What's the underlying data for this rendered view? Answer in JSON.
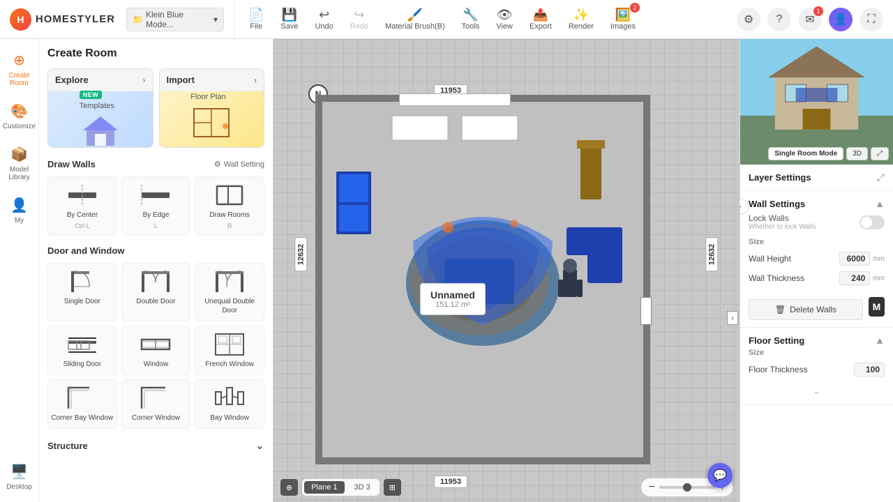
{
  "app": {
    "name": "HOMESTYLER",
    "file": "Klein Blue Mode...",
    "logo_letter": "H"
  },
  "toolbar": {
    "file_label": "File",
    "save_label": "Save",
    "undo_label": "Undo",
    "redo_label": "Redo",
    "material_brush_label": "Material Brush(B)",
    "tools_label": "Tools",
    "view_label": "View",
    "export_label": "Export",
    "render_label": "Render",
    "images_label": "Images",
    "images_badge": "2"
  },
  "sidebar": {
    "create_room_title": "Create Room",
    "explore_label": "Explore",
    "explore_sub": "Templates",
    "new_badge": "NEW",
    "import_label": "Import",
    "import_sub": "Floor Plan",
    "draw_walls_title": "Draw Walls",
    "wall_setting_label": "Wall Setting",
    "walls": [
      {
        "label": "By Center",
        "shortcut": "Ctrl L",
        "icon": "⬜"
      },
      {
        "label": "By Edge",
        "shortcut": "L",
        "icon": "⬜"
      },
      {
        "label": "Draw Rooms",
        "shortcut": "R",
        "icon": "⬜"
      }
    ],
    "door_window_title": "Door and Window",
    "items": [
      {
        "label": "Single Door",
        "icon": "🚪"
      },
      {
        "label": "Double Door",
        "icon": "🚪"
      },
      {
        "label": "Unequal Double Door",
        "icon": "🚪"
      },
      {
        "label": "Sliding Door",
        "icon": "⊟"
      },
      {
        "label": "Window",
        "icon": "⊡"
      },
      {
        "label": "French Window",
        "icon": "⊠"
      },
      {
        "label": "Corner Bay Window",
        "icon": "⌐"
      },
      {
        "label": "Corner Window",
        "icon": "⌐"
      },
      {
        "label": "Bay Window",
        "icon": "⊞"
      }
    ],
    "structure_title": "Structure"
  },
  "nav": [
    {
      "label": "Create Room",
      "icon": "⊕",
      "active": true
    },
    {
      "label": "Customize",
      "icon": "🎨"
    },
    {
      "label": "Model Library",
      "icon": "📦"
    },
    {
      "label": "My",
      "icon": "👤"
    },
    {
      "label": "Desktop",
      "icon": "🖥️"
    }
  ],
  "canvas": {
    "room_name": "Unnamed",
    "room_area": "151.12 m²",
    "dim_top": "11953",
    "dim_bottom": "11953",
    "dim_left": "12632",
    "dim_right": "12632",
    "plane1_label": "Plane 1",
    "plane2_label": "3D 3"
  },
  "right_panel": {
    "preview_mode_single": "Single Room Mode",
    "preview_mode_3d": "3D",
    "layer_settings_title": "Layer Settings",
    "wall_settings_title": "Wall Settings",
    "lock_walls_label": "Lock Walls",
    "lock_walls_sub": "Whether to lock Walls",
    "size_label": "Size",
    "wall_height_label": "Wall Height",
    "wall_height_value": "6000",
    "wall_height_unit": "mm",
    "wall_thickness_label": "Wall Thickness",
    "wall_thickness_value": "240",
    "wall_thickness_unit": "mm",
    "delete_walls_label": "Delete Walls",
    "floor_setting_title": "Floor Setting",
    "floor_size_label": "Size",
    "floor_thickness_label": "Floor Thickness",
    "floor_thickness_value": "100"
  }
}
